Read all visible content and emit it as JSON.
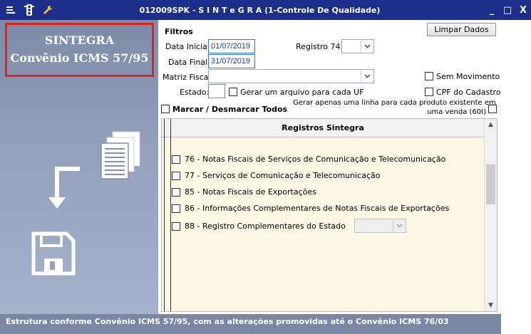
{
  "titlebar": {
    "title": "012009SPK - S I N T e G R A (1-Controle De Qualidade)",
    "minimize": "_",
    "maximize": "□",
    "close": "X"
  },
  "brand": {
    "line1": "SINTEGRA",
    "line2": "Convênio ICMS 57/95"
  },
  "filters": {
    "section_label": "Filtros",
    "clear_button": "Limpar Dados",
    "data_inicial_label": "Data Inicial:",
    "data_inicial_value": "01/07/2019",
    "data_final_label": "Data Final:",
    "data_final_value": "31/07/2019",
    "registro74_label": "Registro 74:",
    "matriz_label": "Matriz Fiscal:",
    "estado_label": "Estado:",
    "gerar_uf_label": "Gerar um arquivo para cada UF",
    "sem_movimento_label": "Sem Movimento",
    "cpf_cadastro_label": "CPF do Cadastro",
    "marcar_label": "Marcar / Desmarcar Todos",
    "gerar_linha_label1": "Gerar apenas uma linha para cada produto existente em",
    "gerar_linha_label2": "uma venda (60I)"
  },
  "grid": {
    "header": "Registros Sintegra",
    "rows": [
      {
        "label": "76 - Notas Fiscais de Serviços de Comunicação e Telecomunicação"
      },
      {
        "label": "77 - Serviços de Comunicação e Telecomunicação"
      },
      {
        "label": "85 - Notas Fiscais de Exportações"
      },
      {
        "label": "86 - Informações Complementares de Notas Fiscais de Exportações"
      },
      {
        "label": "88 - Registro Complementares do Estado"
      }
    ]
  },
  "statusbar": {
    "text": "Estrutura conforme Convênio ICMS 57/95, com as alterações promovidas até o Convênio ICMS 76/03"
  },
  "colors": {
    "titlebar": "#1b2f8a",
    "brand_border": "#e2231a",
    "panel": "#93a1bd",
    "grid_bg": "#fdf8e6"
  }
}
